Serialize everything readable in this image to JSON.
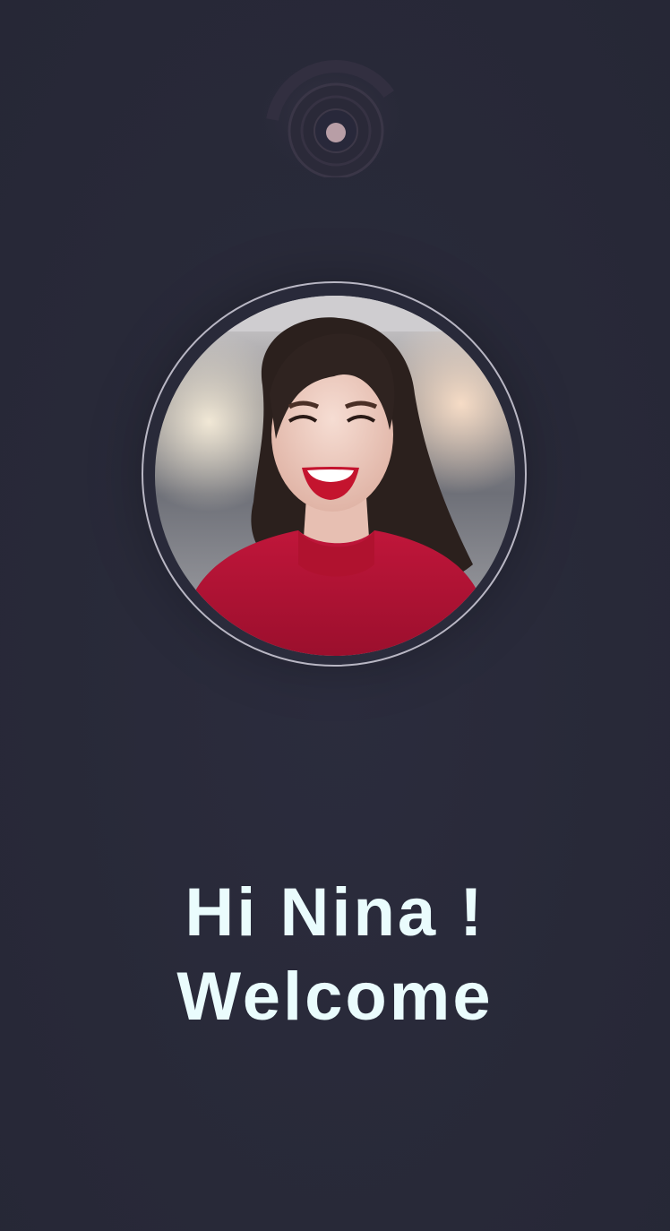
{
  "app": {
    "logo_icon": "signal-waves-icon",
    "avatar_icon": "user-avatar-photo"
  },
  "welcome": {
    "line1": "Hi Nina !",
    "line2": "Welcome"
  },
  "colors": {
    "background": "#292a3a",
    "text": "#eafcfd",
    "ring": "#b9b7c4",
    "logo_dot": "#b89ea6"
  }
}
